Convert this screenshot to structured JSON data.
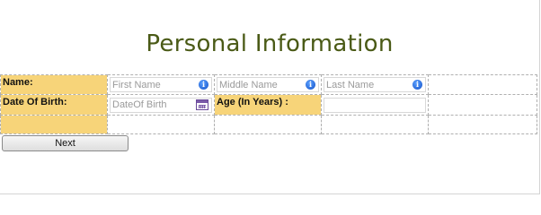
{
  "page": {
    "title": "Personal Information"
  },
  "form": {
    "name_label": "Name:",
    "first_name_placeholder": "First Name",
    "middle_name_placeholder": "Middle Name",
    "last_name_placeholder": "Last Name",
    "dob_label": "Date Of Birth:",
    "dob_placeholder": "DateOf Birth",
    "age_label": "Age (In Years) :",
    "age_value": ""
  },
  "actions": {
    "next_label": "Next"
  },
  "icons": {
    "info": "info-icon",
    "calendar": "calendar-icon"
  },
  "colors": {
    "label_bg": "#f7d479",
    "title": "#4a5a16"
  }
}
